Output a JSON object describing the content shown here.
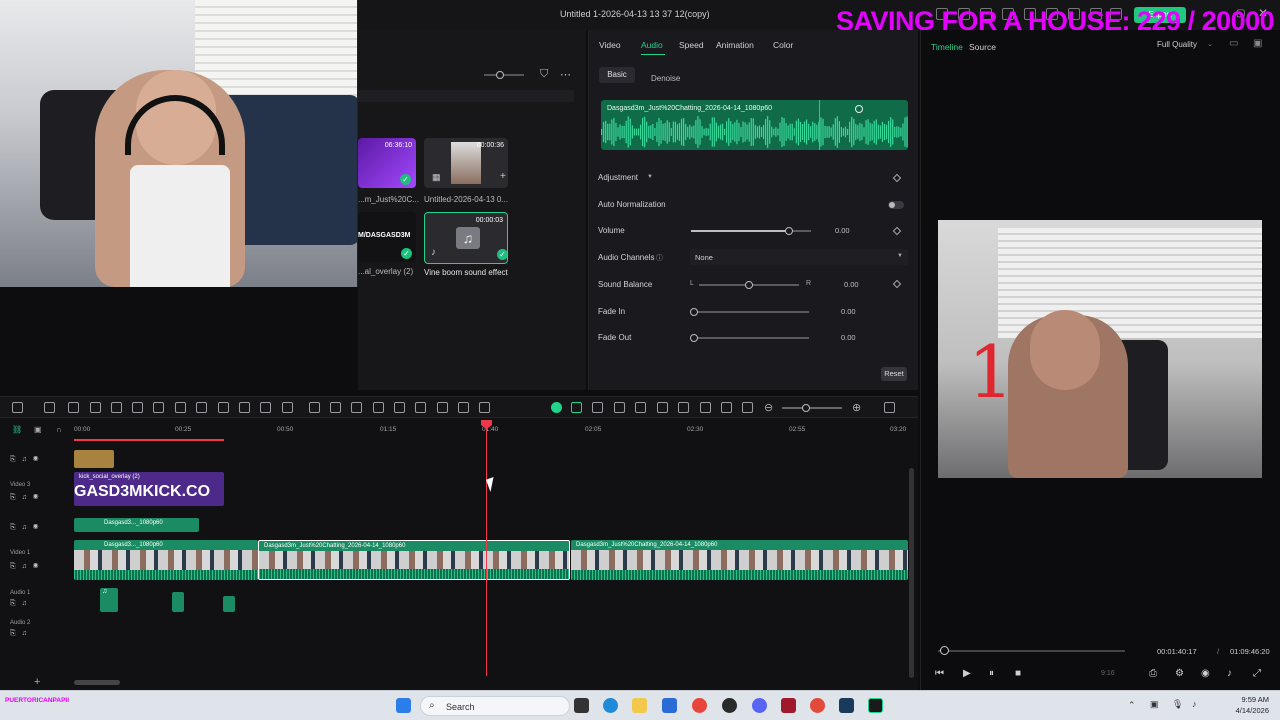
{
  "window": {
    "title": "Untitled 1-2026-04-13 13 37 12(copy)"
  },
  "overlay": {
    "goal_text": "SAVING FOR A HOUSE: 229 / 20000"
  },
  "header": {
    "export_label": "Export"
  },
  "media": {
    "items": [
      {
        "duration": "06:36:10",
        "name": "...m_Just%20C..."
      },
      {
        "duration": "00:00:36",
        "name": "Untitled-2026-04-13 0..."
      },
      {
        "duration": "",
        "name": "...al_overlay (2)",
        "badge": "M/DASGASD3M"
      },
      {
        "duration": "00:00:03",
        "name": "Vine boom sound effect"
      }
    ]
  },
  "properties": {
    "tabs": [
      "Video",
      "Audio",
      "Speed",
      "Animation",
      "Color"
    ],
    "active_tab": "Audio",
    "subtabs": {
      "basic": "Basic",
      "denoise": "Denoise"
    },
    "clip_name": "Dasgasd3m_Just%20Chatting_2026-04-14_1080p60",
    "adjustment_label": "Adjustment",
    "auto_normalization": {
      "label": "Auto Normalization",
      "on": false
    },
    "volume": {
      "label": "Volume",
      "value": "0.00",
      "level": 0.82
    },
    "audio_channels": {
      "label": "Audio Channels",
      "value": "None"
    },
    "sound_balance": {
      "label": "Sound Balance",
      "left": "L",
      "right": "R",
      "value": "0.00",
      "level": 0.5
    },
    "fade_in": {
      "label": "Fade In",
      "value": "0.00",
      "level": 0
    },
    "fade_out": {
      "label": "Fade Out",
      "value": "0.00",
      "level": 0
    },
    "reset_label": "Reset"
  },
  "preview": {
    "tabs": {
      "timeline": "Timeline",
      "source": "Source"
    },
    "quality": "Full Quality",
    "current_time": "00:01:40:17",
    "separator": "/",
    "total_time": "01:09:46:20",
    "progress": 0.024,
    "aspect": "9:16"
  },
  "timeline": {
    "ruler": [
      "00:00",
      "00:25",
      "00:50",
      "01:15",
      "01:40",
      "02:05",
      "02:30",
      "02:55",
      "03:20"
    ],
    "tracks": {
      "video3": "Video 3",
      "video1": "Video 1",
      "audio1": "Audio 1",
      "audio2": "Audio 2"
    },
    "clips": {
      "overlay_name": "kick_social_overlay (2)",
      "overlay_text": "GASD3MKICK.CO",
      "v2_name": "Dasgasd3..._1080p60",
      "v1a_name": "Dasgasd3..._1080p60",
      "v1b_name": "Dasgasd3m_Just%20Chatting_2026-04-14_1080p60",
      "v1c_name": "Dasgasd3m_Just%20Chatting_2026-04-14_1080p60"
    }
  },
  "taskbar": {
    "user": "PUERTORICANPAPII",
    "search_placeholder": "Search",
    "time": "9:59 AM",
    "date": "4/14/2026"
  },
  "colors": {
    "accent": "#22d38b",
    "playhead": "#f0384b",
    "overlay": "#e400ff",
    "clip": "#1b8b63"
  }
}
